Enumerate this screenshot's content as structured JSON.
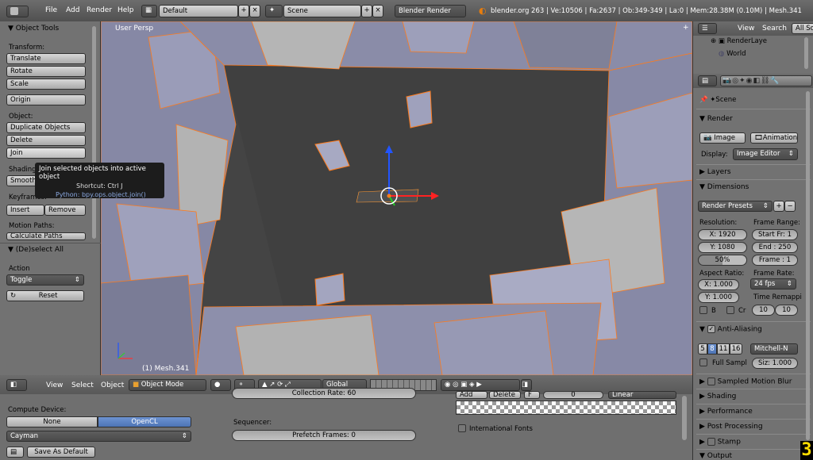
{
  "topbar": {
    "menu": [
      "File",
      "Add",
      "Render",
      "Help"
    ],
    "screen": "Default",
    "scene": "Scene",
    "engine": "Blender Render",
    "stats": "blender.org 263 | Ve:10506 | Fa:2637 | Ob:349-349 | La:0 | Mem:28.38M (0.10M) | Mesh.341"
  },
  "toolshelf": {
    "title": "Object Tools",
    "transform_label": "Transform:",
    "transform": [
      "Translate",
      "Rotate",
      "Scale"
    ],
    "origin": "Origin",
    "object_label": "Object:",
    "object": [
      "Duplicate Objects",
      "Delete",
      "Join"
    ],
    "shading_label": "Shading:",
    "smooth": "Smooth",
    "keyframes_label": "Keyframes:",
    "insert": "Insert",
    "remove": "Remove",
    "motion_label": "Motion Paths:",
    "calc": "Calculate Paths",
    "operator": "(De)select All",
    "action_label": "Action",
    "action_value": "Toggle",
    "reset": "Reset"
  },
  "tooltip": {
    "title": "Join selected objects into active object",
    "shortcut": "Shortcut: Ctrl J",
    "python": "Python: bpy.ops.object.join()"
  },
  "viewport": {
    "view_name": "User Persp",
    "object_name": "(1) Mesh.341"
  },
  "vheader": {
    "menu": [
      "View",
      "Select",
      "Object"
    ],
    "mode": "Object Mode",
    "orientation": "Global"
  },
  "bottom": {
    "compute_label": "Compute Device:",
    "none": "None",
    "opencl": "OpenCL",
    "device": "Cayman",
    "save": "Save As Default",
    "sequencer_label": "Sequencer:",
    "prefetch": "Prefetch Frames: 0",
    "collection": "Collection Rate: 60",
    "intl": "International Fonts",
    "add": "Add",
    "del": "Delete",
    "f": "F",
    "zero": "0",
    "linear": "Linear"
  },
  "outliner": {
    "view": "View",
    "search": "Search",
    "all": "All Sc",
    "render_layers": "RenderLaye",
    "world": "World"
  },
  "props": {
    "scene": "Scene",
    "render": "Render",
    "image": "Image",
    "animation": "Animation",
    "display_label": "Display:",
    "display_value": "Image Editor",
    "layers": "Layers",
    "dimensions": "Dimensions",
    "presets": "Render Presets",
    "resolution_label": "Resolution:",
    "res_x": "X: 1920",
    "res_y": "Y: 1080",
    "res_pct": "50%",
    "frame_range_label": "Frame Range:",
    "start": "Start Fr: 1",
    "end": "End : 250",
    "frame": "Frame : 1",
    "aspect_label": "Aspect Ratio:",
    "asp_x": "X: 1.000",
    "asp_y": "Y: 1.000",
    "frame_rate_label": "Frame Rate:",
    "fps": "24 fps",
    "remap_label": "Time Remappi",
    "remap_old": "10",
    "remap_new": "10",
    "b": "B",
    "cr": "Cr",
    "aa": "Anti-Aliasing",
    "aa_samples": [
      "5",
      "8",
      "11",
      "16"
    ],
    "aa_filter": "Mitchell-N",
    "full_sample": "Full Sampl",
    "size": "Siz: 1.000",
    "motion_blur": "Sampled Motion Blur",
    "shading": "Shading",
    "performance": "Performance",
    "post": "Post Processing",
    "stamp": "Stamp",
    "output": "Output"
  },
  "colors": {
    "accent": "#ffdd00",
    "select": "#ff7a1a",
    "active_blue": "#5680c2"
  }
}
